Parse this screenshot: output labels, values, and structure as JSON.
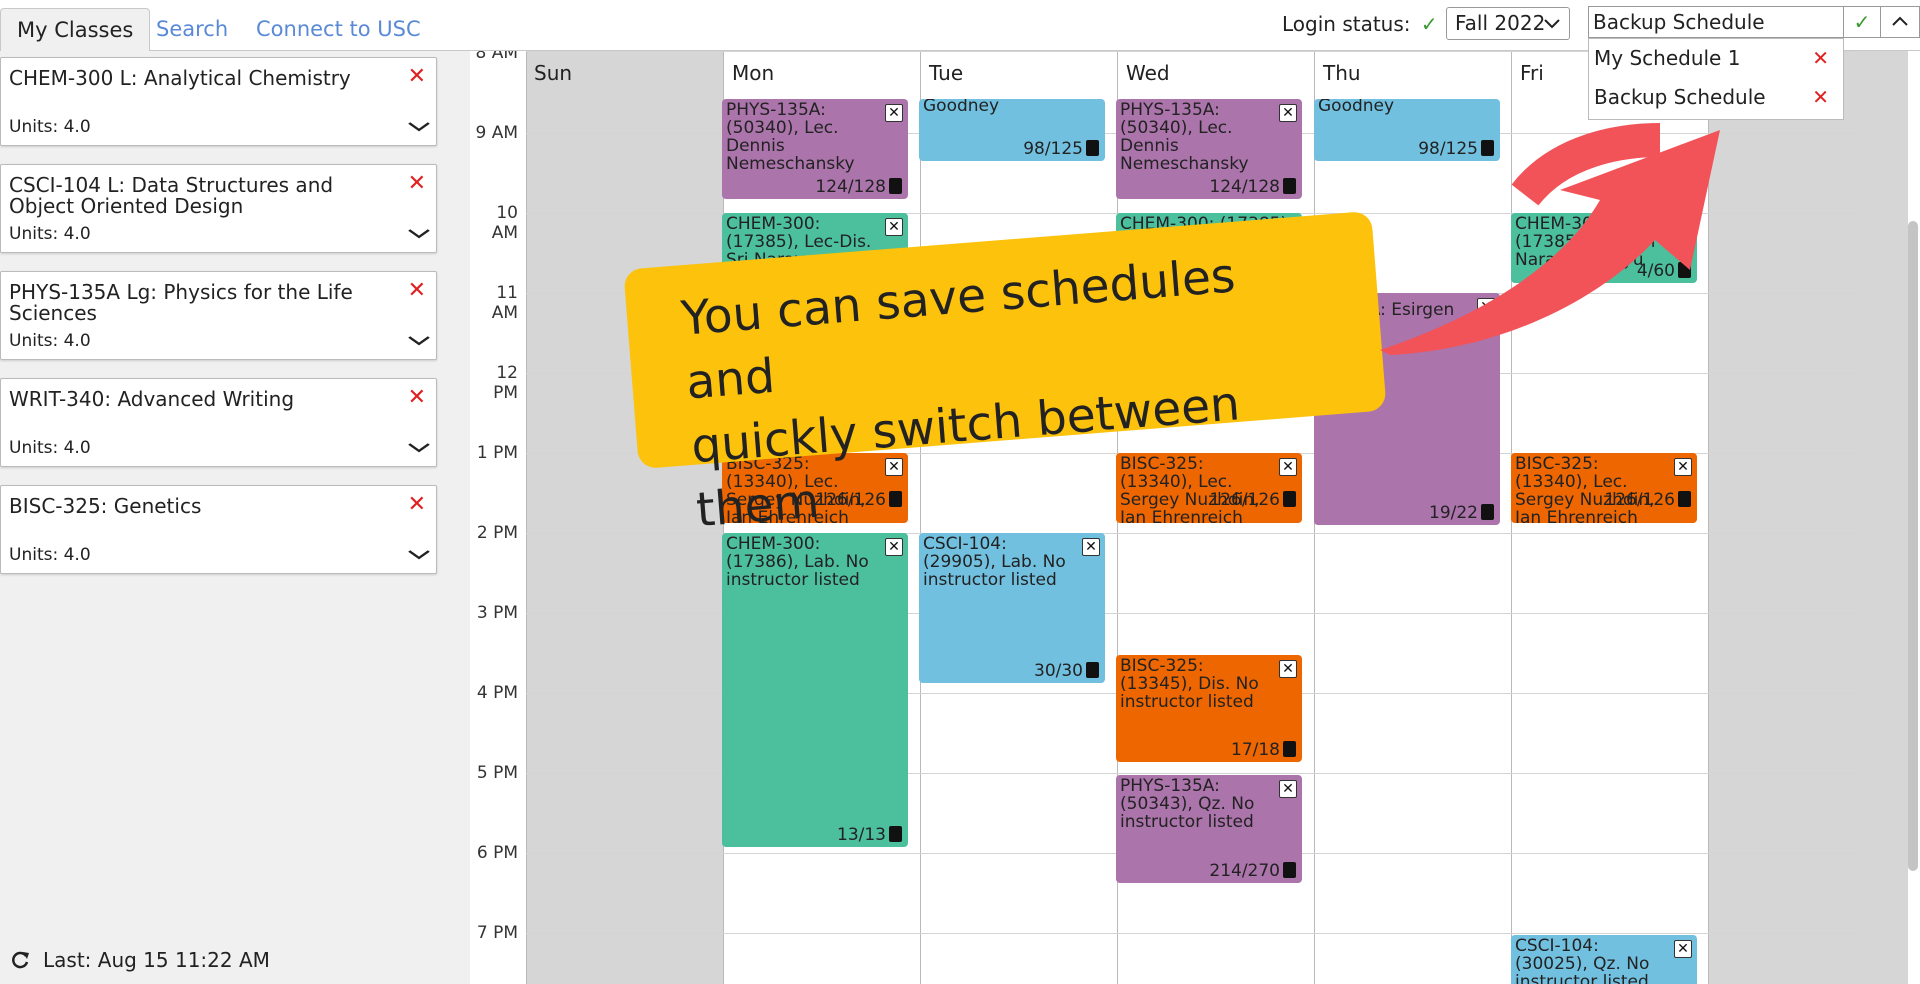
{
  "tabs": [
    {
      "label": "My Classes"
    },
    {
      "label": "Search"
    },
    {
      "label": "Connect to USC"
    }
  ],
  "header": {
    "login_label": "Login status:",
    "login_check": "✓",
    "term": "Fall 2022",
    "schedule_name": "Backup Schedule",
    "schedules": [
      "My Schedule 1",
      "Backup Schedule"
    ]
  },
  "classes": [
    {
      "title": "CHEM-300 L: Analytical Chemistry",
      "units": "Units: 4.0"
    },
    {
      "title": "CSCI-104 L: Data Structures and Object Oriented Design",
      "units": "Units: 4.0"
    },
    {
      "title": "PHYS-135A Lg: Physics for the Life Sciences",
      "units": "Units: 4.0"
    },
    {
      "title": "WRIT-340: Advanced Writing",
      "units": "Units: 4.0"
    },
    {
      "title": "BISC-325: Genetics",
      "units": "Units: 4.0"
    }
  ],
  "last_sync": "Last: Aug 15 11:22 AM",
  "calendar": {
    "hours": [
      "8 AM",
      "9 AM",
      "10 AM",
      "11 AM",
      "12 PM",
      "1 PM",
      "2 PM",
      "3 PM",
      "4 PM",
      "5 PM",
      "6 PM",
      "7 PM"
    ],
    "days": [
      "Sun",
      "Mon",
      "Tue",
      "Wed",
      "Thu",
      "Fri"
    ],
    "events": {
      "mon_phys": {
        "text": "PHYS-135A: (50340), Lec. Dennis Nemeschansky",
        "seats": "124/128"
      },
      "tue_writ": {
        "text": "Goodney",
        "seats": "98/125"
      },
      "wed_phys": {
        "text": "PHYS-135A: (50340), Lec. Dennis Nemeschansky",
        "seats": "124/128"
      },
      "thu_writ": {
        "text": "Goodney",
        "seats": "98/125"
      },
      "mon_chem": {
        "text": "CHEM-300: (17385), Lec-Dis. Sri Narayan, Michael"
      },
      "wed_chem": {
        "text": "CHEM-300: (17385)"
      },
      "fri_chem": {
        "text": "CHEM-300: (17385), Lec. Sri Narayan, Inkyu",
        "seats": "4/60"
      },
      "thu_phys": {
        "text": "5A: Esirgen",
        "seats": "19/22"
      },
      "mon_bisc": {
        "text": "BISC-325: (13340), Lec. Sergey Nuzhdin, Ian Ehrenreich",
        "seats": "126/126"
      },
      "wed_bisc": {
        "text": "BISC-325: (13340), Lec. Sergey Nuzhdin, Ian Ehrenreich",
        "seats": "126/126"
      },
      "fri_bisc": {
        "text": "BISC-325: (13340), Lec. Sergey Nuzhdin, Ian Ehrenreich",
        "seats": "126/126"
      },
      "mon_chemlab": {
        "text": "CHEM-300: (17386), Lab. No instructor listed",
        "seats": "13/13"
      },
      "tue_csci": {
        "text": "CSCI-104: (29905), Lab. No instructor listed",
        "seats": "30/30"
      },
      "wed_biscdis": {
        "text": "BISC-325: (13345), Dis. No instructor listed",
        "seats": "17/18"
      },
      "wed_physqz": {
        "text": "PHYS-135A: (50343), Qz. No instructor listed",
        "seats": "214/270"
      },
      "fri_csciqz": {
        "text": "CSCI-104: (30025), Qz. No instructor listed"
      }
    }
  },
  "callout": {
    "line1": "You can save schedules and",
    "line2": "quickly switch between them"
  },
  "colors": {
    "purple": "#ab74ab",
    "blue": "#72c0e0",
    "green": "#4cbf9c",
    "orange": "#ee6600",
    "banner": "#fcc20c",
    "arrow": "#f25359"
  },
  "icons": {
    "refresh": "refresh-icon",
    "remove": "close-icon",
    "expand": "chevron-down-icon",
    "seats": "clipboard-check-icon"
  }
}
